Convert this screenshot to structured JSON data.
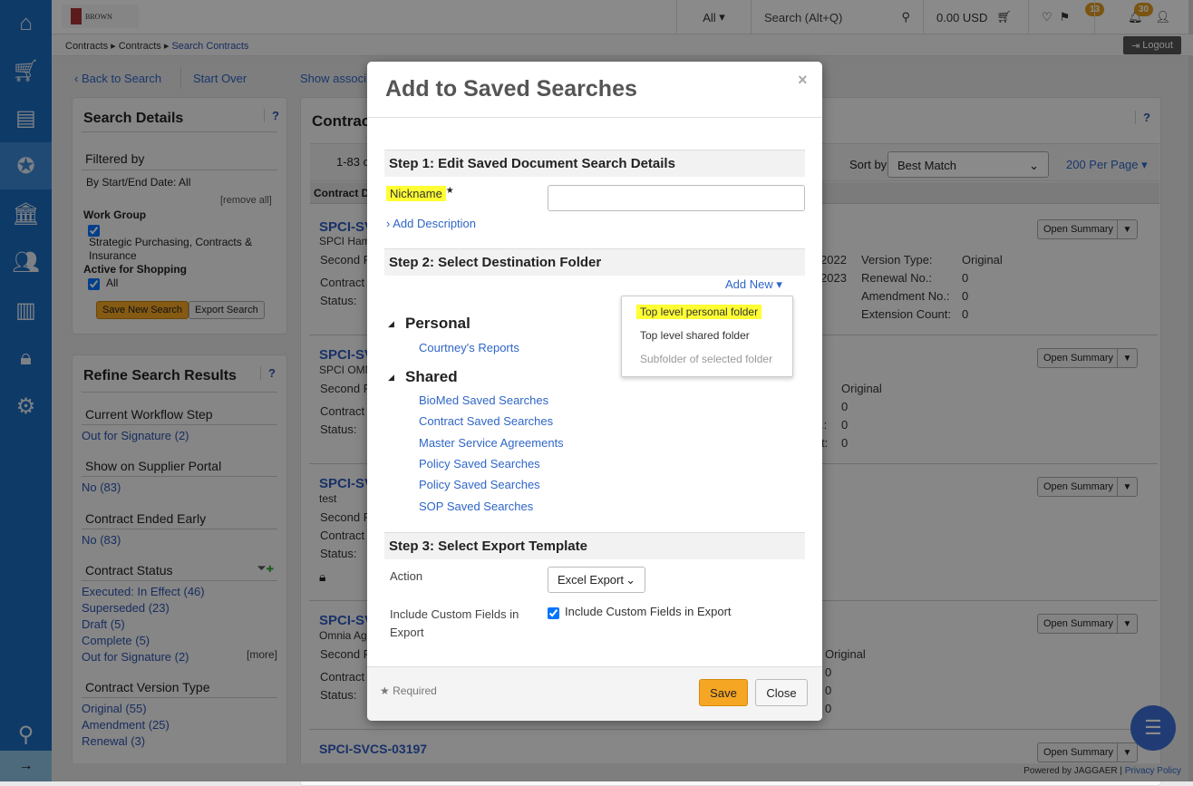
{
  "colors": {
    "sidebar": "#1b6bc0",
    "accent": "#f5a623",
    "link": "#2f66c7",
    "highlight": "#ffff33",
    "badge": "#e39b1c"
  },
  "sidebar": {
    "items": [
      {
        "icon": "home-icon"
      },
      {
        "icon": "cart-icon"
      },
      {
        "icon": "documents-clock-icon"
      },
      {
        "icon": "contract-ribbon-icon",
        "active": true
      },
      {
        "icon": "bank-icon"
      },
      {
        "icon": "suppliers-icon"
      },
      {
        "icon": "bar-chart-icon"
      },
      {
        "icon": "lock-gear-icon"
      },
      {
        "icon": "gear-icon"
      },
      {
        "icon": "search-icon"
      },
      {
        "icon": "expand-arrow-icon"
      }
    ]
  },
  "topbar": {
    "logo": "BROWN",
    "scope": "All",
    "search_placeholder": "Search (Alt+Q)",
    "cart_total": "0.00 USD",
    "flag_count": "13",
    "notification_count": "30",
    "logout": "Logout"
  },
  "breadcrumb": [
    "Contracts",
    "Contracts",
    "Search Contracts"
  ],
  "actions": {
    "back": "Back to Search",
    "start_over": "Start Over",
    "show_assoc": "Show associ"
  },
  "search_details": {
    "title": "Search Details",
    "help": "?",
    "filtered_by": "Filtered by",
    "date_filter": "By Start/End Date: All",
    "remove_all": "[remove all]",
    "work_group_label": "Work Group",
    "work_group_value": "Strategic Purchasing, Contracts & Insurance",
    "active_label": "Active for Shopping",
    "active_value": "All",
    "save_new": "Save New Search",
    "export": "Export Search"
  },
  "refine": {
    "title": "Refine Search Results",
    "help": "?",
    "more": "[more]",
    "sections": [
      {
        "title": "Current Workflow Step",
        "items": [
          "Out for Signature (2)"
        ]
      },
      {
        "title": "Show on Supplier Portal",
        "items": [
          "No (83)"
        ]
      },
      {
        "title": "Contract Ended Early",
        "items": [
          "No (83)"
        ]
      },
      {
        "title": "Contract Status",
        "items": [
          "Executed: In Effect (46)",
          "Superseded (23)",
          "Draft (5)",
          "Complete (5)",
          "Out for Signature (2)"
        ]
      },
      {
        "title": "Contract Version Type",
        "items": [
          "Original (55)",
          "Amendment (25)",
          "Renewal (3)"
        ]
      }
    ]
  },
  "results": {
    "title": "Contrac",
    "help": "?",
    "count": "1-83 c",
    "sort_label": "Sort by",
    "sort_value": "Best Match",
    "per_page": "200 Per Page",
    "col_header": "Contract D",
    "open_summary": "Open Summary",
    "rows": [
      {
        "title": "SPCI-SV",
        "sub": "SPCI Ham",
        "f1": "Second F",
        "f2": "Contract",
        "f3": "Status:",
        "dates": [
          "2022",
          "2023"
        ],
        "labels": [
          "Version Type:",
          "Renewal No.:",
          "Amendment No.:",
          "Extension Count:"
        ],
        "values": [
          "Original",
          "0",
          "0",
          "0"
        ]
      },
      {
        "title": "SPCI-SV",
        "sub": "SPCI OMN",
        "f1": "Second F",
        "f2": "Contract",
        "f3": "Status:",
        "labels": [
          "",
          ".:",
          "t:"
        ],
        "values": [
          "Original",
          "0",
          "0",
          "0"
        ]
      },
      {
        "title": "SPCI-SV",
        "sub": "test",
        "f1": "Second F",
        "f2": "Contract",
        "f3": "Status:"
      },
      {
        "title": "SPCI-SV",
        "sub": "Omnia Agr",
        "f1": "Second F",
        "f2": "Contract",
        "f3": "Status:",
        "values": [
          "Original",
          "0",
          "0",
          "0"
        ]
      },
      {
        "title": "SPCI-SVCS-03197"
      }
    ]
  },
  "footer": {
    "powered": "Powered by JAGGAER |",
    "privacy": "Privacy Policy"
  },
  "modal": {
    "title": "Add to Saved Searches",
    "close": "×",
    "step1": "Step 1: Edit Saved Document Search Details",
    "nickname_label": "Nickname",
    "required_star": "★",
    "nickname_value": "",
    "add_description": "Add Description",
    "step2": "Step 2: Select Destination Folder",
    "add_new": "Add New",
    "add_new_menu": [
      "Top level personal folder",
      "Top level shared folder",
      "Subfolder of selected folder"
    ],
    "personal": "Personal",
    "personal_folders": [
      "Courtney's Reports"
    ],
    "shared": "Shared",
    "shared_folders": [
      "BioMed Saved Searches",
      "Contract Saved Searches",
      "Master Service Agreements",
      "Policy Saved Searches",
      "Policy Saved Searches",
      "SOP Saved Searches"
    ],
    "step3": "Step 3: Select Export Template",
    "action_label": "Action",
    "action_value": "Excel Export",
    "custom_label": "Include Custom Fields in Export",
    "custom_checkbox": "Include Custom Fields in Export",
    "custom_checked": true,
    "required_note": "Required",
    "save": "Save",
    "close_btn": "Close"
  }
}
